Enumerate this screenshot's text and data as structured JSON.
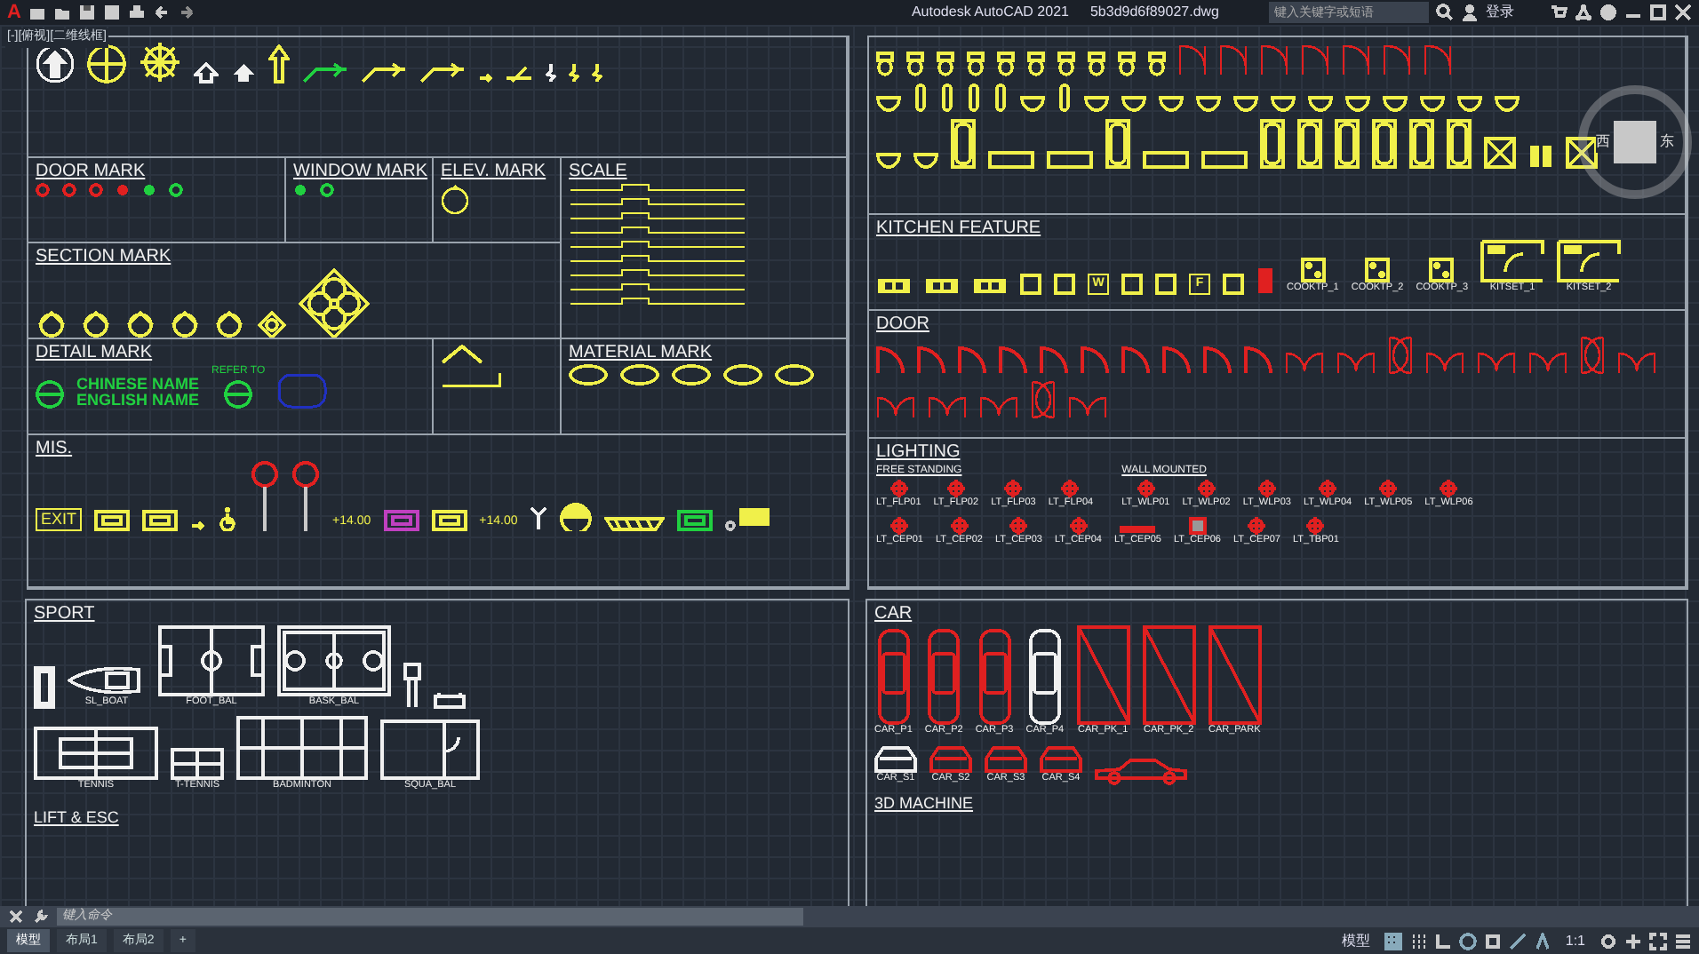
{
  "title_bar": {
    "logo": "A",
    "app": "Autodesk AutoCAD 2021",
    "file": "5b3d9d6f89027.dwg",
    "search": {
      "placeholder": "键入关键字或短语"
    },
    "sign_in": "登录"
  },
  "viewport_label": "[-][俯视][二维线框]",
  "viewcube": {
    "west": "西",
    "east": "东"
  },
  "left_panels": [
    {
      "groups": [
        {
          "items": [
            {
              "kind": "arrow-circle",
              "color": "#f0f0f0"
            },
            {
              "kind": "north-circle",
              "color": "#f0f04a"
            },
            {
              "kind": "compass",
              "color": "#f0f04a"
            },
            {
              "kind": "arrow-outline",
              "color": "#f0f0f0"
            },
            {
              "kind": "arrow-solid",
              "color": "#f0f0f0"
            },
            {
              "kind": "arrow-tall",
              "color": "#f0f04a"
            },
            {
              "kind": "leader",
              "color": "#20d040"
            },
            {
              "kind": "leader",
              "color": "#f0f04a"
            },
            {
              "kind": "leader",
              "color": "#f0f04a"
            },
            {
              "kind": "tick",
              "color": "#f0f04a"
            },
            {
              "kind": "cut-line",
              "color": "#f0f04a"
            },
            {
              "kind": "break",
              "color": "#f0f0f0"
            },
            {
              "kind": "break",
              "color": "#f0f04a"
            },
            {
              "kind": "break",
              "color": "#f0f04a"
            }
          ]
        }
      ]
    },
    {
      "title": "DOOR MARK",
      "groups": [
        {
          "items": [
            {
              "kind": "small-circle",
              "color": "#e02020"
            },
            {
              "kind": "small-circle",
              "color": "#e02020"
            },
            {
              "kind": "small-circle",
              "color": "#e02020"
            },
            {
              "kind": "dot-circle",
              "color": "#e02020"
            },
            {
              "kind": "dot-circle",
              "color": "#20d040"
            },
            {
              "kind": "small-circle",
              "color": "#20d040"
            }
          ]
        }
      ]
    },
    {
      "title": "WINDOW MARK",
      "groups": [
        {
          "items": [
            {
              "kind": "dot-circle",
              "color": "#20d040"
            },
            {
              "kind": "small-circle",
              "color": "#20d040"
            }
          ]
        }
      ]
    },
    {
      "title": "ELEV. MARK",
      "groups": [
        {
          "items": [
            {
              "kind": "elev",
              "color": "#f0f04a"
            }
          ]
        }
      ]
    },
    {
      "title": "SCALE",
      "groups": [
        {
          "items": [
            {
              "kind": "scale-bar",
              "color": "#f0f04a"
            },
            {
              "kind": "scale-bar",
              "color": "#f0f04a"
            },
            {
              "kind": "scale-bar",
              "color": "#f0f04a"
            },
            {
              "kind": "scale-bar",
              "color": "#f0f04a"
            },
            {
              "kind": "scale-bar",
              "color": "#f0f04a"
            },
            {
              "kind": "scale-bar",
              "color": "#f0f04a"
            },
            {
              "kind": "scale-bar",
              "color": "#f0f04a"
            },
            {
              "kind": "scale-bar",
              "color": "#f0f04a"
            },
            {
              "kind": "scale-bar",
              "color": "#f0f04a"
            }
          ]
        }
      ]
    },
    {
      "title": "SECTION MARK",
      "groups": [
        {
          "items": [
            {
              "kind": "section",
              "color": "#f0f04a"
            },
            {
              "kind": "section",
              "color": "#f0f04a"
            },
            {
              "kind": "section",
              "color": "#f0f04a"
            },
            {
              "kind": "section",
              "color": "#f0f04a"
            },
            {
              "kind": "section",
              "color": "#f0f04a"
            },
            {
              "kind": "diamond",
              "color": "#f0f04a"
            },
            {
              "kind": "big-diamond",
              "color": "#f0f04a"
            }
          ]
        }
      ]
    },
    {
      "title": "DETAIL MARK",
      "groups": [
        {
          "items": [
            {
              "kind": "detail-circle",
              "color": "#20d040"
            },
            {
              "kind": "name-tag",
              "color": "#20d040",
              "lines": [
                "CHINESE NAME",
                "ENGLISH NAME"
              ]
            },
            {
              "kind": "refer",
              "color": "#20d040",
              "text": "REFER TO"
            },
            {
              "kind": "cloud",
              "color": "#2030c0"
            }
          ]
        }
      ]
    },
    {
      "groups": [
        {
          "items": [
            {
              "kind": "arch",
              "color": "#f0f04a"
            },
            {
              "kind": "angle",
              "color": "#f0f04a"
            }
          ]
        }
      ]
    },
    {
      "title": "MATERIAL MARK",
      "groups": [
        {
          "items": [
            {
              "kind": "ellipse",
              "color": "#f0f04a"
            },
            {
              "kind": "ellipse",
              "color": "#f0f04a"
            },
            {
              "kind": "ellipse",
              "color": "#f0f04a"
            },
            {
              "kind": "ellipse",
              "color": "#f0f04a"
            },
            {
              "kind": "ellipse",
              "color": "#f0f04a"
            }
          ]
        }
      ]
    },
    {
      "title": "MIS.",
      "groups": [
        {
          "items": [
            {
              "kind": "sign",
              "color": "#f0f04a",
              "text": "EXIT"
            },
            {
              "kind": "sign-box",
              "color": "#f0f04a"
            },
            {
              "kind": "sign-box",
              "color": "#f0f04a"
            },
            {
              "kind": "tick",
              "color": "#f0f04a"
            },
            {
              "kind": "wheelchair",
              "color": "#f0f04a"
            },
            {
              "kind": "grid-circle",
              "color": "#e02020"
            },
            {
              "kind": "grid-circle",
              "color": "#e02020"
            },
            {
              "kind": "level",
              "color": "#f0f04a",
              "text": "+14.00"
            },
            {
              "kind": "sign-box",
              "color": "#c040c0"
            },
            {
              "kind": "sign-box",
              "color": "#f0f04a"
            },
            {
              "kind": "level",
              "color": "#f0f04a",
              "text": "+14.00"
            },
            {
              "kind": "antenna",
              "color": "#f0f0f0"
            },
            {
              "kind": "half-circle",
              "color": "#f0f04a"
            },
            {
              "kind": "hatch",
              "color": "#f0f04a"
            },
            {
              "kind": "sign-box",
              "color": "#20d040"
            },
            {
              "kind": "tag",
              "color": "#f0f04a"
            }
          ]
        }
      ]
    }
  ],
  "right_panels": [
    {
      "groups": [
        {
          "items": [
            {
              "kind": "toilet",
              "color": "#f0f04a"
            },
            {
              "kind": "toilet",
              "color": "#f0f04a"
            },
            {
              "kind": "toilet",
              "color": "#f0f04a"
            },
            {
              "kind": "toilet",
              "color": "#f0f04a"
            },
            {
              "kind": "toilet",
              "color": "#f0f04a"
            },
            {
              "kind": "toilet",
              "color": "#f0f04a"
            },
            {
              "kind": "toilet",
              "color": "#f0f04a"
            },
            {
              "kind": "toilet",
              "color": "#f0f04a"
            },
            {
              "kind": "toilet",
              "color": "#f0f04a"
            },
            {
              "kind": "toilet",
              "color": "#f0f04a"
            },
            {
              "kind": "stall",
              "color": "#e02020"
            },
            {
              "kind": "stall",
              "color": "#e02020"
            },
            {
              "kind": "stall",
              "color": "#e02020"
            },
            {
              "kind": "stall",
              "color": "#e02020"
            },
            {
              "kind": "stall",
              "color": "#e02020"
            },
            {
              "kind": "stall",
              "color": "#e02020"
            },
            {
              "kind": "stall",
              "color": "#e02020"
            }
          ]
        },
        {
          "items": [
            {
              "kind": "basin",
              "color": "#f0f04a"
            },
            {
              "kind": "urinal",
              "color": "#f0f04a"
            },
            {
              "kind": "urinal",
              "color": "#f0f04a"
            },
            {
              "kind": "urinal",
              "color": "#f0f04a"
            },
            {
              "kind": "urinal",
              "color": "#f0f04a"
            },
            {
              "kind": "basin",
              "color": "#f0f04a"
            },
            {
              "kind": "urinal",
              "color": "#f0f04a"
            },
            {
              "kind": "basin",
              "color": "#f0f04a"
            },
            {
              "kind": "basin",
              "color": "#f0f04a"
            },
            {
              "kind": "basin",
              "color": "#f0f04a"
            },
            {
              "kind": "basin",
              "color": "#f0f04a"
            },
            {
              "kind": "basin",
              "color": "#f0f04a"
            },
            {
              "kind": "basin",
              "color": "#f0f04a"
            },
            {
              "kind": "basin",
              "color": "#f0f04a"
            },
            {
              "kind": "basin",
              "color": "#f0f04a"
            },
            {
              "kind": "basin",
              "color": "#f0f04a"
            },
            {
              "kind": "basin",
              "color": "#f0f04a"
            },
            {
              "kind": "basin",
              "color": "#f0f04a"
            },
            {
              "kind": "basin",
              "color": "#f0f04a"
            }
          ]
        },
        {
          "items": [
            {
              "kind": "basin",
              "color": "#f0f04a"
            },
            {
              "kind": "basin",
              "color": "#f0f04a"
            },
            {
              "kind": "bath",
              "color": "#f0f04a"
            },
            {
              "kind": "tray",
              "color": "#f0f04a"
            },
            {
              "kind": "tray",
              "color": "#f0f04a"
            },
            {
              "kind": "bath",
              "color": "#f0f04a"
            },
            {
              "kind": "tray",
              "color": "#f0f04a"
            },
            {
              "kind": "tray",
              "color": "#f0f04a"
            },
            {
              "kind": "bath",
              "color": "#f0f04a"
            },
            {
              "kind": "bath",
              "color": "#f0f04a"
            },
            {
              "kind": "bath",
              "color": "#f0f04a"
            },
            {
              "kind": "bath",
              "color": "#f0f04a"
            },
            {
              "kind": "bath",
              "color": "#f0f04a"
            },
            {
              "kind": "bath",
              "color": "#f0f04a"
            },
            {
              "kind": "shower",
              "color": "#f0f04a"
            },
            {
              "kind": "shower-tray",
              "color": "#f0f04a"
            },
            {
              "kind": "shower",
              "color": "#f0f04a"
            }
          ]
        }
      ]
    },
    {
      "title": "KITCHEN FEATURE",
      "groups": [
        {
          "items": [
            {
              "kind": "sink",
              "color": "#f0f04a"
            },
            {
              "kind": "sink",
              "color": "#f0f04a"
            },
            {
              "kind": "sink",
              "color": "#f0f04a"
            },
            {
              "kind": "appliance",
              "color": "#f0f04a"
            },
            {
              "kind": "appliance",
              "color": "#f0f04a"
            },
            {
              "kind": "appliance",
              "color": "#f0f04a",
              "text": "W"
            },
            {
              "kind": "appliance",
              "color": "#f0f04a"
            },
            {
              "kind": "appliance",
              "color": "#f0f04a"
            },
            {
              "kind": "appliance",
              "color": "#f0f04a",
              "text": "F"
            },
            {
              "kind": "appliance",
              "color": "#f0f04a"
            },
            {
              "kind": "cabinet",
              "color": "#e02020"
            },
            {
              "kind": "cooktop",
              "color": "#f0f04a",
              "label": "COOKTP_1"
            },
            {
              "kind": "cooktop",
              "color": "#f0f04a",
              "label": "COOKTP_2"
            },
            {
              "kind": "cooktop",
              "color": "#f0f04a",
              "label": "COOKTP_3"
            },
            {
              "kind": "kitchen-set",
              "color": "#f0f04a",
              "label": "KITSET_1"
            },
            {
              "kind": "kitchen-set",
              "color": "#f0f04a",
              "label": "KITSET_2"
            }
          ]
        }
      ]
    },
    {
      "title": "DOOR",
      "groups": [
        {
          "items": [
            {
              "kind": "door",
              "color": "#e02020"
            },
            {
              "kind": "door",
              "color": "#e02020"
            },
            {
              "kind": "door",
              "color": "#e02020"
            },
            {
              "kind": "door",
              "color": "#e02020"
            },
            {
              "kind": "door",
              "color": "#e02020"
            },
            {
              "kind": "door",
              "color": "#e02020"
            },
            {
              "kind": "door",
              "color": "#e02020"
            },
            {
              "kind": "door",
              "color": "#e02020"
            },
            {
              "kind": "door",
              "color": "#e02020"
            },
            {
              "kind": "door",
              "color": "#e02020"
            },
            {
              "kind": "door-pair",
              "color": "#e02020"
            },
            {
              "kind": "door-pair",
              "color": "#e02020"
            },
            {
              "kind": "door-double",
              "color": "#e02020"
            },
            {
              "kind": "door-pair",
              "color": "#e02020"
            },
            {
              "kind": "door-pair",
              "color": "#e02020"
            },
            {
              "kind": "door-pair",
              "color": "#e02020"
            },
            {
              "kind": "door-double",
              "color": "#e02020"
            },
            {
              "kind": "door-pair",
              "color": "#e02020"
            },
            {
              "kind": "door-pair",
              "color": "#e02020"
            },
            {
              "kind": "door-pair",
              "color": "#e02020"
            },
            {
              "kind": "door-pair",
              "color": "#e02020"
            },
            {
              "kind": "door-double",
              "color": "#e02020"
            },
            {
              "kind": "door-pair",
              "color": "#e02020"
            }
          ]
        }
      ]
    },
    {
      "title": "LIGHTING",
      "groups": [
        {
          "title": "FREE STANDING",
          "items": [
            {
              "kind": "light",
              "color": "#e02020",
              "label": "LT_FLP01"
            },
            {
              "kind": "light",
              "color": "#e02020",
              "label": "LT_FLP02"
            },
            {
              "kind": "light",
              "color": "#e02020",
              "label": "LT_FLP03"
            },
            {
              "kind": "light",
              "color": "#e02020",
              "label": "LT_FLP04"
            }
          ]
        },
        {
          "title": "WALL MOUNTED",
          "items": [
            {
              "kind": "light",
              "color": "#e02020",
              "label": "LT_WLP01"
            },
            {
              "kind": "light",
              "color": "#e02020",
              "label": "LT_WLP02"
            },
            {
              "kind": "light",
              "color": "#e02020",
              "label": "LT_WLP03"
            },
            {
              "kind": "light",
              "color": "#e02020",
              "label": "LT_WLP04"
            },
            {
              "kind": "light",
              "color": "#e02020",
              "label": "LT_WLP05"
            },
            {
              "kind": "light",
              "color": "#e02020",
              "label": "LT_WLP06"
            }
          ]
        },
        {
          "items": [
            {
              "kind": "light",
              "color": "#e02020",
              "label": "LT_CEP01"
            },
            {
              "kind": "light",
              "color": "#e02020",
              "label": "LT_CEP02"
            },
            {
              "kind": "light",
              "color": "#e02020",
              "label": "LT_CEP03"
            },
            {
              "kind": "light",
              "color": "#e02020",
              "label": "LT_CEP04"
            },
            {
              "kind": "strip-light",
              "color": "#e02020",
              "label": "LT_CEP05"
            },
            {
              "kind": "panel-light",
              "color": "#e02020",
              "label": "LT_CEP06"
            },
            {
              "kind": "light",
              "color": "#e02020",
              "label": "LT_CEP07"
            },
            {
              "kind": "light",
              "color": "#e02020",
              "label": "LT_TBP01"
            }
          ]
        }
      ]
    }
  ],
  "sport": {
    "title": "SPORT",
    "groups": [
      {
        "items": [
          {
            "kind": "pool-table",
            "color": "#f0f0f0"
          },
          {
            "kind": "boat",
            "color": "#f0f0f0",
            "label": "SL_BOAT"
          },
          {
            "kind": "football-field",
            "color": "#f0f0f0",
            "label": "FOOT_BAL"
          },
          {
            "kind": "basketball-court",
            "color": "#f0f0f0",
            "label": "BASK_BAL"
          },
          {
            "kind": "hoop",
            "color": "#f0f0f0"
          },
          {
            "kind": "bench",
            "color": "#f0f0f0"
          }
        ]
      },
      {
        "items": [
          {
            "kind": "tennis-court",
            "color": "#f0f0f0",
            "label": "TENNIS"
          },
          {
            "kind": "table-tennis",
            "color": "#f0f0f0",
            "label": "T-TENNIS"
          },
          {
            "kind": "badminton-court",
            "color": "#f0f0f0",
            "label": "BADMINTON"
          },
          {
            "kind": "squash-court",
            "color": "#f0f0f0",
            "label": "SQUA_BAL"
          }
        ]
      }
    ]
  },
  "car": {
    "title": "CAR",
    "groups": [
      {
        "items": [
          {
            "kind": "car-top",
            "color": "#e02020",
            "label": "CAR_P1"
          },
          {
            "kind": "car-top",
            "color": "#e02020",
            "label": "CAR_P2"
          },
          {
            "kind": "car-top",
            "color": "#e02020",
            "label": "CAR_P3"
          },
          {
            "kind": "car-top",
            "color": "#f0f0f0",
            "label": "CAR_P4"
          },
          {
            "kind": "parking",
            "color": "#e02020",
            "label": "CAR_PK_1"
          },
          {
            "kind": "parking",
            "color": "#e02020",
            "label": "CAR_PK_2"
          },
          {
            "kind": "parking",
            "color": "#e02020",
            "label": "CAR_PARK"
          }
        ]
      },
      {
        "items": [
          {
            "kind": "car-front",
            "color": "#f0f0f0",
            "label": "CAR_S1"
          },
          {
            "kind": "car-front",
            "color": "#e02020",
            "label": "CAR_S2"
          },
          {
            "kind": "car-front",
            "color": "#e02020",
            "label": "CAR_S3"
          },
          {
            "kind": "car-front",
            "color": "#e02020",
            "label": "CAR_S4"
          },
          {
            "kind": "car-side",
            "color": "#e02020"
          }
        ]
      }
    ]
  },
  "lower_headings": [
    "3D MACHINE",
    "LIFT & ESC"
  ],
  "command_line": {
    "placeholder": "键入命令"
  },
  "layout_tabs": [
    {
      "label": "模型",
      "selected": true
    },
    {
      "label": "布局1",
      "selected": false
    },
    {
      "label": "布局2",
      "selected": false
    }
  ],
  "add_tab": "+",
  "status_bar": {
    "mode": "模型",
    "scale": "1:1"
  }
}
